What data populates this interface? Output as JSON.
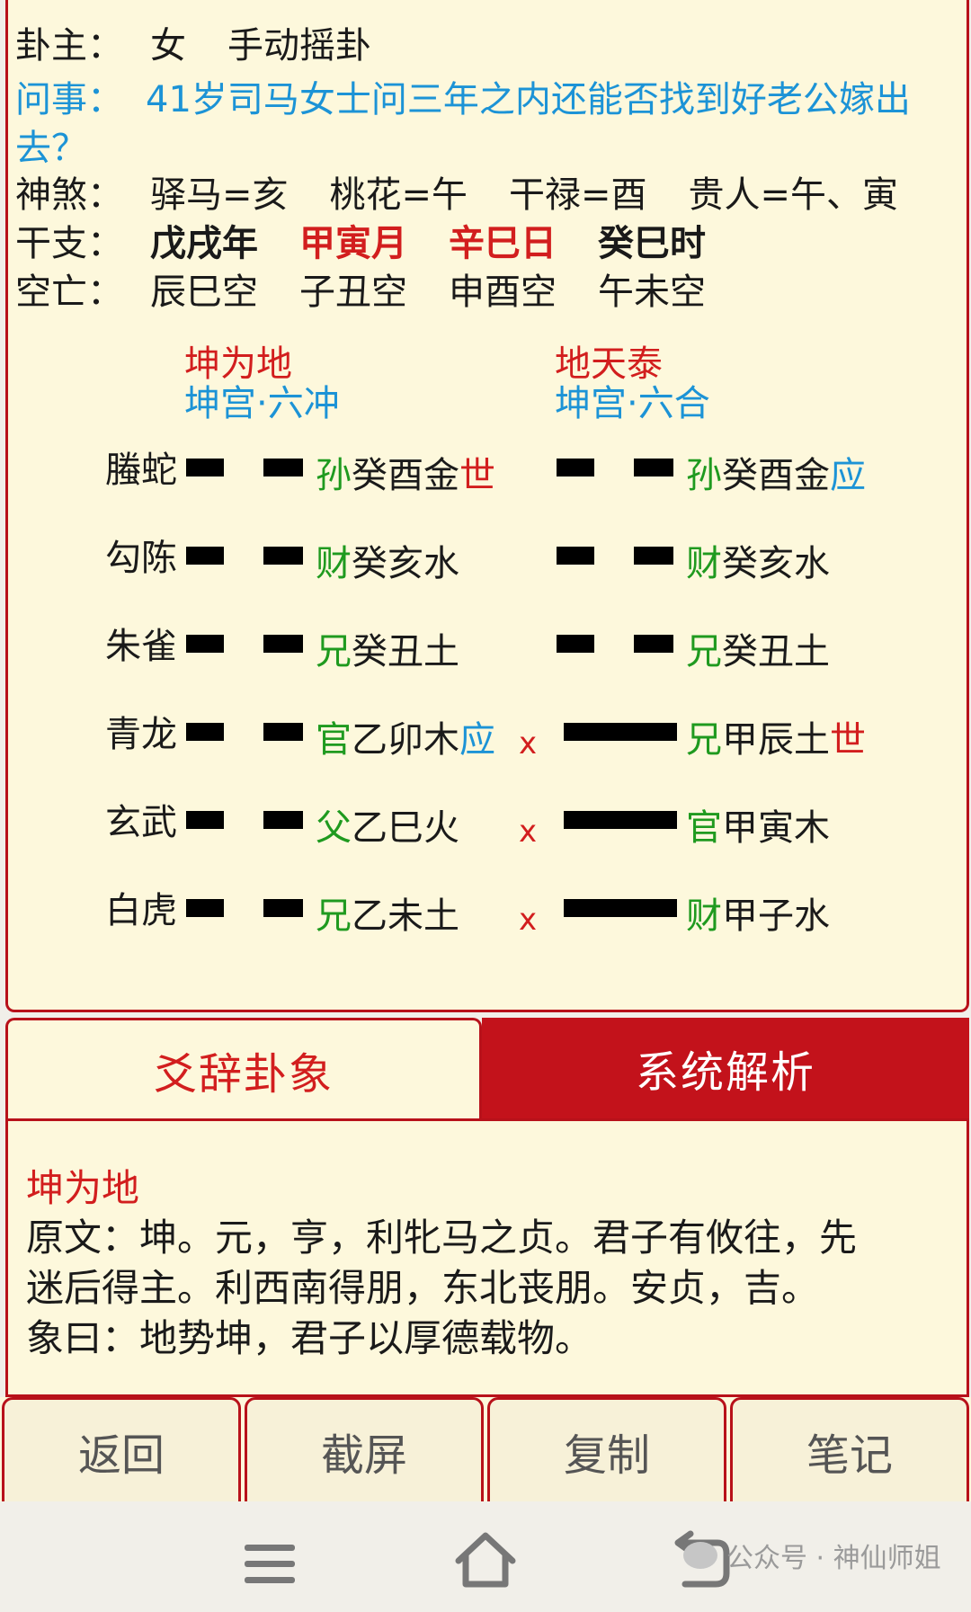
{
  "header": {
    "gua_zhu": {
      "label": "卦主：",
      "gender": "女",
      "method": "手动摇卦"
    },
    "ask": {
      "label": "问事：",
      "text": "41岁司马女士问三年之内还能否找到好老公嫁出去？"
    },
    "shensha": {
      "label": "神煞：",
      "items": [
        "驿马=亥",
        "桃花=午",
        "干禄=酉",
        "贵人=午、寅"
      ]
    },
    "ganzhi": {
      "label": "干支：",
      "year": "戊戌年",
      "month": "甲寅月",
      "day": "辛巳日",
      "hour": "癸巳时"
    },
    "kongwang": {
      "label": "空亡：",
      "items": [
        "辰巳空",
        "子丑空",
        "申酉空",
        "午未空"
      ]
    }
  },
  "main_gua": {
    "name": "坤为地",
    "palace": "坤宫·六冲"
  },
  "changed_gua": {
    "name": "地天泰",
    "palace": "坤宫·六合"
  },
  "lines": [
    {
      "god": "螣蛇",
      "left": {
        "rel": "孙",
        "stem": "癸酉金",
        "mark": "世",
        "mark_color": "red"
      },
      "change": "",
      "right": {
        "rel": "孙",
        "stem": "癸酉金",
        "mark": "应",
        "mark_color": "blue"
      }
    },
    {
      "god": "勾陈",
      "left": {
        "rel": "财",
        "stem": "癸亥水",
        "mark": ""
      },
      "change": "",
      "right": {
        "rel": "财",
        "stem": "癸亥水",
        "mark": ""
      }
    },
    {
      "god": "朱雀",
      "left": {
        "rel": "兄",
        "stem": "癸丑土",
        "mark": ""
      },
      "change": "",
      "right": {
        "rel": "兄",
        "stem": "癸丑土",
        "mark": ""
      }
    },
    {
      "god": "青龙",
      "left": {
        "rel": "官",
        "stem": "乙卯木",
        "mark": "应",
        "mark_color": "blue"
      },
      "change": "x",
      "right": {
        "rel": "兄",
        "stem": "甲辰土",
        "mark": "世",
        "mark_color": "red"
      }
    },
    {
      "god": "玄武",
      "left": {
        "rel": "父",
        "stem": "乙巳火",
        "mark": ""
      },
      "change": "x",
      "right": {
        "rel": "官",
        "stem": "甲寅木",
        "mark": ""
      }
    },
    {
      "god": "白虎",
      "left": {
        "rel": "兄",
        "stem": "乙未土",
        "mark": ""
      },
      "change": "x",
      "right": {
        "rel": "财",
        "stem": "甲子水",
        "mark": ""
      }
    }
  ],
  "tabs": {
    "active": "爻辞卦象",
    "inactive": "系统解析"
  },
  "explanation": {
    "title": "坤为地",
    "line1": "原文：坤。元，亨，利牝马之贞。君子有攸往，先",
    "line2": "迷后得主。利西南得朋，东北丧朋。安贞，吉。",
    "line3": "象曰：地势坤，君子以厚德载物。"
  },
  "buttons": {
    "back": "返回",
    "screenshot": "截屏",
    "copy": "复制",
    "notes": "笔记"
  },
  "watermark": "公众号 · 神仙师姐",
  "colors": {
    "accent_red": "#c3121b",
    "panel_bg": "#fdf8dc",
    "blue": "#1c93d6",
    "green": "#1f9a1f"
  }
}
